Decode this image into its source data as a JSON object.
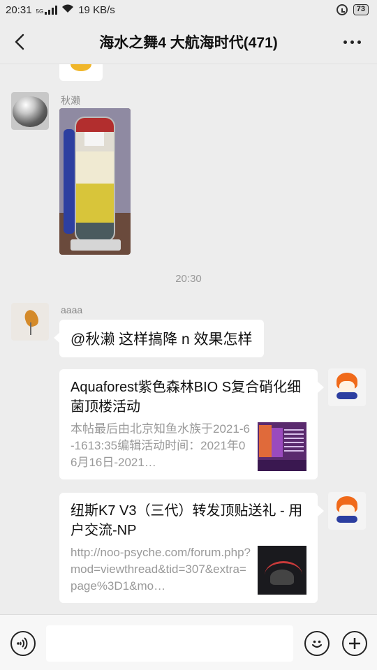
{
  "status_bar": {
    "time": "20:31",
    "network_type": "5G",
    "speed": "19 KB/s",
    "battery": "73",
    "icons": [
      "signal-icon",
      "wifi-icon",
      "alarm-icon",
      "battery-icon"
    ]
  },
  "header": {
    "title": "海水之舞4 大航海时代(471)",
    "back_icon": "chevron-left-icon",
    "more_icon": "more-dots-icon"
  },
  "messages": [
    {
      "type": "image",
      "sender": "秋濑",
      "avatar_icon": "metal-sphere-avatar",
      "image_desc": "photo-reactor-icon"
    },
    {
      "type": "time",
      "text": "20:30"
    },
    {
      "type": "text",
      "sender": "aaaa",
      "avatar_icon": "plant-avatar",
      "text": "@秋濑  这样搞降 n 效果怎样"
    },
    {
      "type": "link",
      "self": true,
      "title": "Aquaforest紫色森林BIO S复合硝化细菌顶楼活动",
      "desc": "本帖最后由北京知鱼水族于2021-6-1613:35编辑活动时间：2021年06月16日-2021…",
      "thumb_icon": "product-thumbnail"
    },
    {
      "type": "link",
      "self": true,
      "title": "纽斯K7 V3（三代）转发顶贴送礼 - 用户交流-NP",
      "desc": "http://noo-psyche.com/forum.php?mod=viewthread&tid=307&extra=page%3D1&mo…",
      "thumb_icon": "lamp-thumbnail"
    }
  ],
  "input_bar": {
    "voice_icon": "voice-icon",
    "emoji_icon": "emoji-icon",
    "plus_icon": "plus-icon",
    "placeholder": ""
  },
  "colors": {
    "background": "#ededed",
    "bubble": "#ffffff",
    "text": "#111111",
    "secondary_text": "#999999"
  }
}
